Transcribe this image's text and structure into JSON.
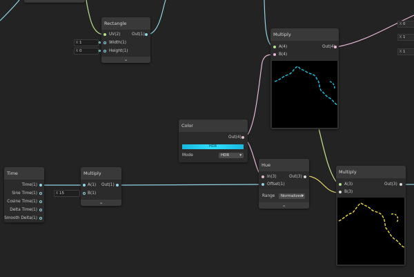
{
  "nodes": {
    "rectangle": {
      "title": "Rectangle",
      "inputs": [
        "UV(2)",
        "Width(1)",
        "Height(1)"
      ],
      "output": "Out(1)",
      "width_field": {
        "axis": "X",
        "value": "1"
      },
      "height_field": {
        "axis": "X",
        "value": "0"
      },
      "collapse": "⌄"
    },
    "multiply_top": {
      "title": "Multiply",
      "inputs": [
        "A(4)",
        "B(4)"
      ],
      "output": "Out(4)"
    },
    "color": {
      "title": "Color",
      "output": "Out(4)",
      "swatch_label": "HDR",
      "mode_label": "Mode",
      "mode_value": "HDR"
    },
    "time": {
      "title": "Time",
      "outputs": [
        "Time(1)",
        "Sine Time(1)",
        "Cosine Time(1)",
        "Delta Time(1)",
        "Smooth Delta(1)"
      ]
    },
    "multiply_mid": {
      "title": "Multiply",
      "inputs": [
        "A(1)",
        "B(1)"
      ],
      "output": "Out(1)",
      "b_field": {
        "axis": "X",
        "value": "15"
      },
      "collapse": "⌄"
    },
    "hue": {
      "title": "Hue",
      "inputs": [
        "In(3)",
        "Offset(1)"
      ],
      "output": "Out(3)",
      "range_label": "Range",
      "range_value": "Normalized",
      "collapse": "⌄"
    },
    "multiply_bottom": {
      "title": "Multiply",
      "inputs": [
        "A(3)",
        "B(3)"
      ],
      "output": "Out(3)"
    }
  },
  "right_edge_fields": [
    {
      "axis": "X",
      "value": "0"
    },
    {
      "axis": "X",
      "value": "1"
    },
    {
      "axis": "X",
      "value": "1"
    }
  ],
  "colors": {
    "canvas": "#232323",
    "wire_cyan": "#8fd6e6",
    "wire_pink": "#e8b8d8",
    "wire_green": "#c8e68a",
    "wire_yellow": "#e8d86a",
    "hdr_cyan": "#1fd0f0"
  }
}
